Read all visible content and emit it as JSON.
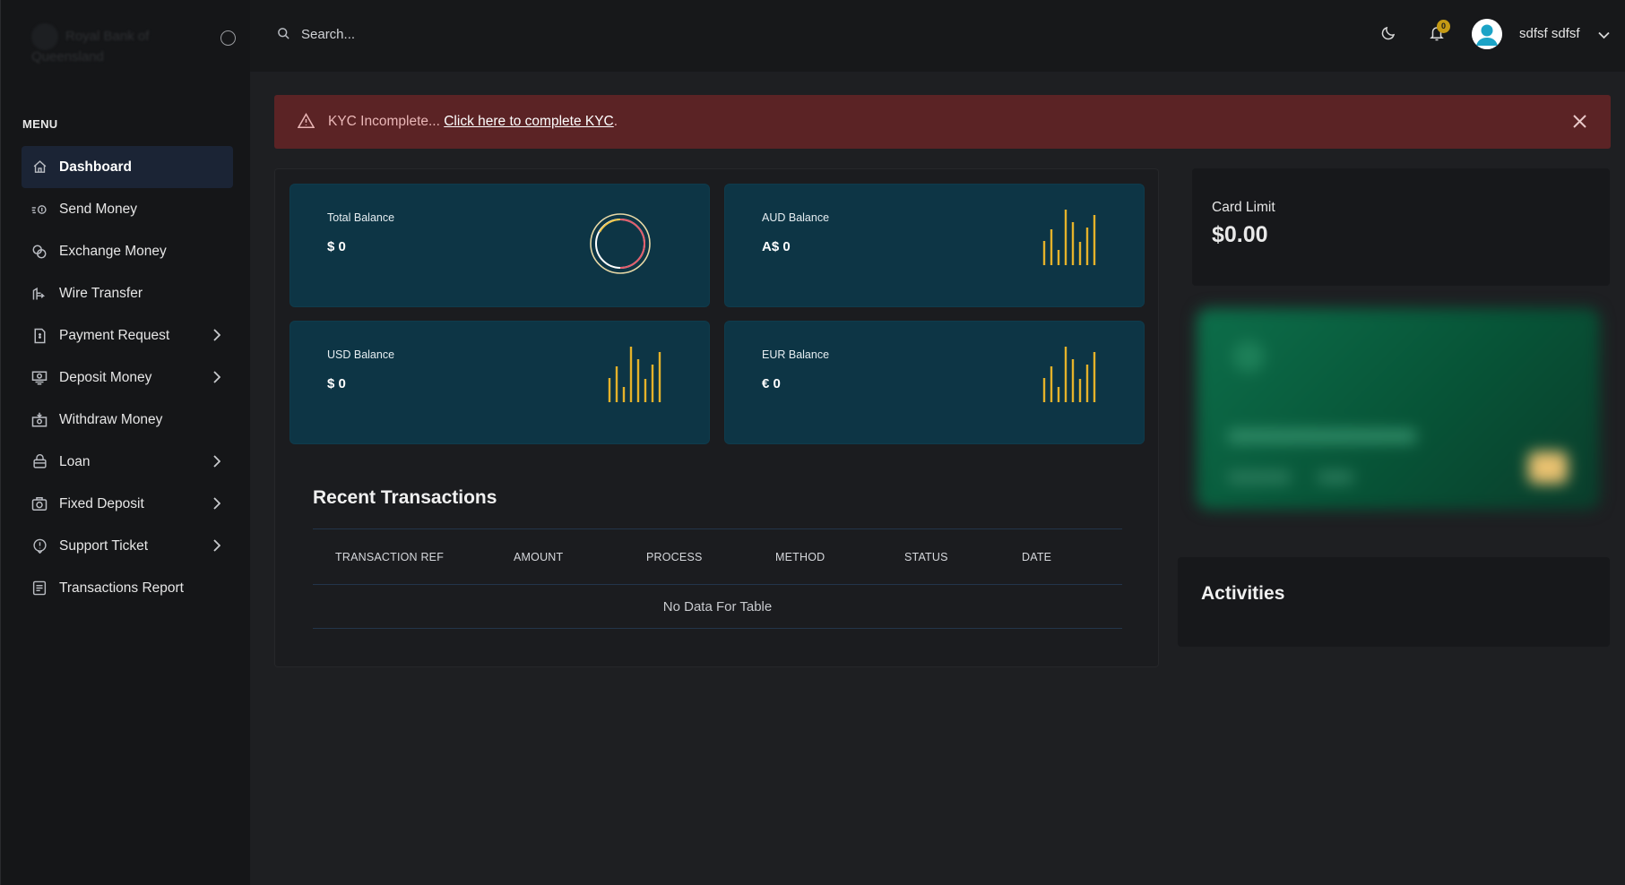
{
  "brand": {
    "name": "Royal Bank of Queensland"
  },
  "sidebar": {
    "menu_title": "MENU",
    "items": [
      {
        "label": "Dashboard",
        "icon": "home-icon",
        "active": true,
        "has_children": false
      },
      {
        "label": "Send Money",
        "icon": "send-money-icon",
        "active": false,
        "has_children": false
      },
      {
        "label": "Exchange Money",
        "icon": "exchange-icon",
        "active": false,
        "has_children": false
      },
      {
        "label": "Wire Transfer",
        "icon": "wire-transfer-icon",
        "active": false,
        "has_children": false
      },
      {
        "label": "Payment Request",
        "icon": "payment-request-icon",
        "active": false,
        "has_children": true
      },
      {
        "label": "Deposit Money",
        "icon": "deposit-icon",
        "active": false,
        "has_children": true
      },
      {
        "label": "Withdraw Money",
        "icon": "withdraw-icon",
        "active": false,
        "has_children": false
      },
      {
        "label": "Loan",
        "icon": "loan-icon",
        "active": false,
        "has_children": true
      },
      {
        "label": "Fixed Deposit",
        "icon": "fixed-deposit-icon",
        "active": false,
        "has_children": true
      },
      {
        "label": "Support Ticket",
        "icon": "support-icon",
        "active": false,
        "has_children": true
      },
      {
        "label": "Transactions Report",
        "icon": "report-icon",
        "active": false,
        "has_children": false
      }
    ]
  },
  "topbar": {
    "search_placeholder": "Search...",
    "notification_count": "0",
    "username": "sdfsf sdfsf"
  },
  "alert": {
    "text": "KYC Incomplete... ",
    "link_text": "Click here to complete KYC",
    "suffix": "."
  },
  "balances": [
    {
      "title": "Total Balance",
      "value": "$ 0",
      "graphic": "ring"
    },
    {
      "title": "AUD Balance",
      "value": "A$ 0",
      "graphic": "bars"
    },
    {
      "title": "USD Balance",
      "value": "$ 0",
      "graphic": "bars"
    },
    {
      "title": "EUR Balance",
      "value": "€ 0",
      "graphic": "bars"
    }
  ],
  "recent_transactions": {
    "title": "Recent Transactions",
    "columns": [
      "TRANSACTION REF",
      "AMOUNT",
      "PROCESS",
      "METHOD",
      "STATUS",
      "DATE"
    ],
    "empty_text": "No Data For Table"
  },
  "card_limit": {
    "title": "Card Limit",
    "value": "$0.00"
  },
  "activities": {
    "title": "Activities"
  },
  "colors": {
    "accent_gold": "#c59a14",
    "card_bg": "#0d3545",
    "alert_bg": "#5b2325",
    "active_menu_bg": "#1b2435"
  }
}
